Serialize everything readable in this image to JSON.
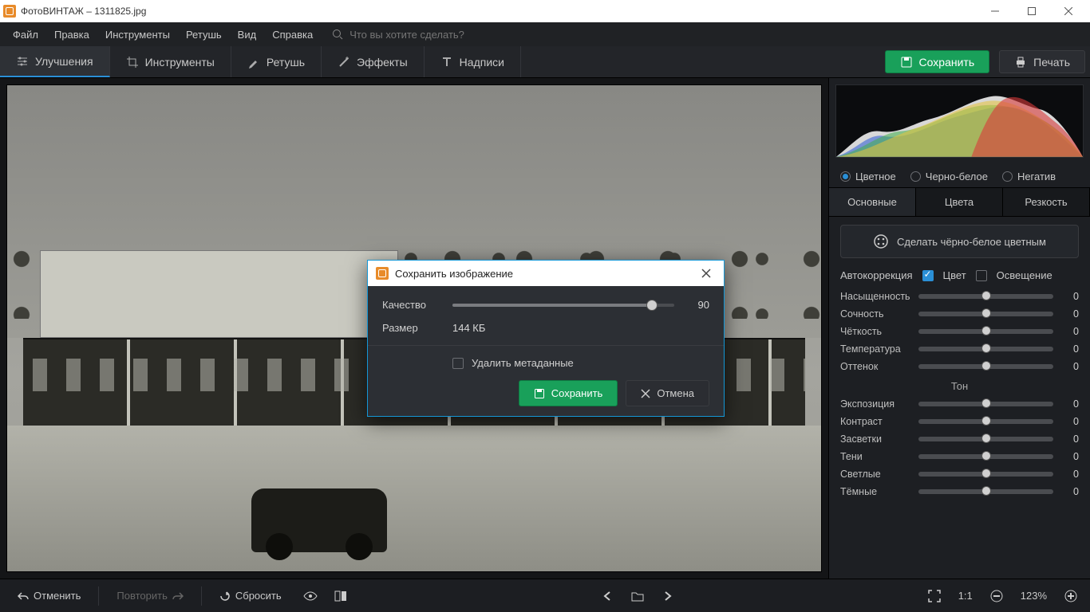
{
  "app": {
    "title": "ФотоВИНТАЖ – 1311825.jpg"
  },
  "menu": {
    "items": [
      "Файл",
      "Правка",
      "Инструменты",
      "Ретушь",
      "Вид",
      "Справка"
    ],
    "search_placeholder": "Что вы хотите сделать?"
  },
  "tooltabs": {
    "tabs": [
      {
        "label": "Улучшения",
        "active": true
      },
      {
        "label": "Инструменты"
      },
      {
        "label": "Ретушь"
      },
      {
        "label": "Эффекты"
      },
      {
        "label": "Надписи"
      }
    ],
    "save": "Сохранить",
    "print": "Печать"
  },
  "colormode": {
    "options": [
      "Цветное",
      "Черно-белое",
      "Негатив"
    ],
    "selected": 0
  },
  "proptabs": {
    "tabs": [
      "Основные",
      "Цвета",
      "Резкость"
    ],
    "active": 0
  },
  "bw_button": "Сделать чёрно-белое цветным",
  "autocorr": {
    "label": "Автокоррекция",
    "color_label": "Цвет",
    "color_checked": true,
    "light_label": "Освещение",
    "light_checked": false
  },
  "props": {
    "color_rows": [
      {
        "label": "Насыщенность",
        "value": 0,
        "grad": "grad-sat"
      },
      {
        "label": "Сочность",
        "value": 0,
        "grad": "grad-vib"
      },
      {
        "label": "Чёткость",
        "value": 0,
        "grad": ""
      },
      {
        "label": "Температура",
        "value": 0,
        "grad": "grad-temp"
      },
      {
        "label": "Оттенок",
        "value": 0,
        "grad": "grad-tint"
      }
    ],
    "tone_title": "Тон",
    "tone_rows": [
      {
        "label": "Экспозиция",
        "value": 0
      },
      {
        "label": "Контраст",
        "value": 0
      },
      {
        "label": "Засветки",
        "value": 0
      },
      {
        "label": "Тени",
        "value": 0
      },
      {
        "label": "Светлые",
        "value": 0
      },
      {
        "label": "Тёмные",
        "value": 0
      }
    ]
  },
  "bottombar": {
    "undo": "Отменить",
    "redo": "Повторить",
    "reset": "Сбросить",
    "ratio": "1:1",
    "zoom": "123%"
  },
  "modal": {
    "title": "Сохранить изображение",
    "quality_label": "Качество",
    "quality_value": "90",
    "size_label": "Размер",
    "size_value": "144 КБ",
    "delete_meta": "Удалить метаданные",
    "save": "Сохранить",
    "cancel": "Отмена"
  }
}
